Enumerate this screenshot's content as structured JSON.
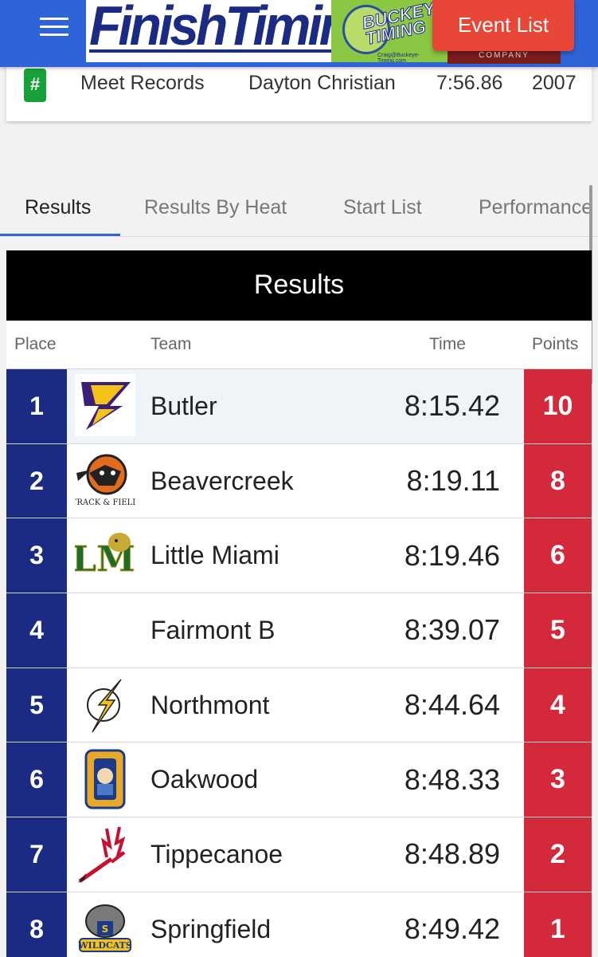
{
  "header": {
    "event_list_label": "Event List",
    "logo_text": "FinishTiming",
    "partner_logo_text": "BUCKEYE TIMING",
    "partner_email": "Craig@Buckeye-Timing.com",
    "company_label": "COMPANY"
  },
  "record": {
    "badge": "#",
    "label": "Meet Records",
    "school": "Dayton Christian",
    "time": "7:56.86",
    "year": "2007"
  },
  "tabs": [
    {
      "label": "Results"
    },
    {
      "label": "Results By Heat"
    },
    {
      "label": "Start List"
    },
    {
      "label": "Performance"
    }
  ],
  "results": {
    "title": "Results",
    "columns": {
      "place": "Place",
      "team": "Team",
      "time": "Time",
      "points": "Points"
    },
    "rows": [
      {
        "place": "1",
        "team": "Butler",
        "time": "8:15.42",
        "points": "10",
        "logo": "butler-logo-icon"
      },
      {
        "place": "2",
        "team": "Beavercreek",
        "time": "8:19.11",
        "points": "8",
        "logo": "beavercreek-logo-icon",
        "logo_text": "TRACK & FIELD"
      },
      {
        "place": "3",
        "team": "Little Miami",
        "time": "8:19.46",
        "points": "6",
        "logo": "little-miami-logo-icon",
        "logo_text": "LM"
      },
      {
        "place": "4",
        "team": "Fairmont B",
        "time": "8:39.07",
        "points": "5",
        "logo": ""
      },
      {
        "place": "5",
        "team": "Northmont",
        "time": "8:44.64",
        "points": "4",
        "logo": "northmont-logo-icon"
      },
      {
        "place": "6",
        "team": "Oakwood",
        "time": "8:48.33",
        "points": "3",
        "logo": "oakwood-logo-icon"
      },
      {
        "place": "7",
        "team": "Tippecanoe",
        "time": "8:48.89",
        "points": "2",
        "logo": "tippecanoe-logo-icon"
      },
      {
        "place": "8",
        "team": "Springfield",
        "time": "8:49.42",
        "points": "1",
        "logo": "springfield-logo-icon",
        "logo_text": "WILDCATS"
      }
    ]
  },
  "colors": {
    "header_blue": "#2f63d8",
    "place_navy": "#1b2a83",
    "points_red": "#d3293a",
    "event_button_red": "#e84637",
    "badge_green": "#16a13a"
  }
}
